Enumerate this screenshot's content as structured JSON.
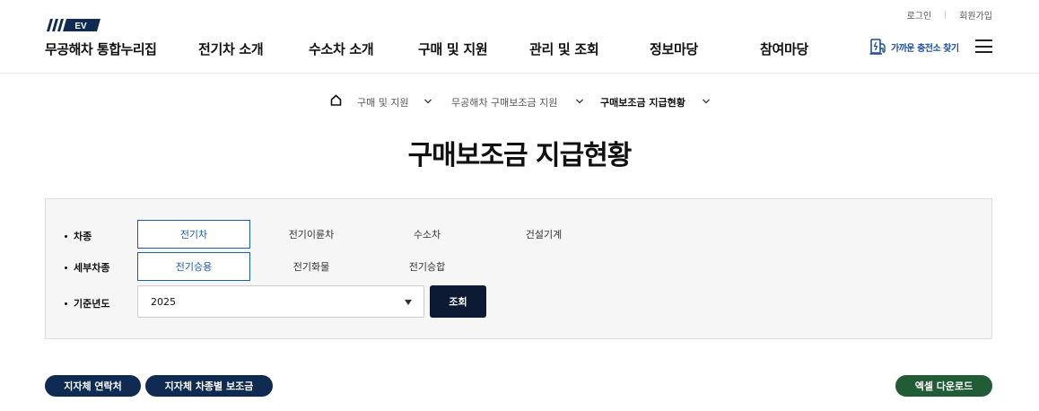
{
  "header": {
    "logo_badge": "EV",
    "logo_text": "무공해차 통합누리집",
    "util": {
      "login": "로그인",
      "signup": "회원가입"
    },
    "nav": [
      "전기차 소개",
      "수소차 소개",
      "구매 및 지원",
      "관리 및 조회",
      "정보마당",
      "참여마당"
    ],
    "charger_label": "가까운 충전소 찾기"
  },
  "breadcrumb": {
    "items": [
      "구매 및 지원",
      "무공해차 구매보조금 지원",
      "구매보조금 지급현황"
    ]
  },
  "page_title": "구매보조금 지급현황",
  "filters": {
    "vehicle_type": {
      "label": "차종",
      "options": [
        "전기차",
        "전기이륜차",
        "수소차",
        "건설기계"
      ],
      "selected": "전기차"
    },
    "sub_type": {
      "label": "세부차종",
      "options": [
        "전기승용",
        "전기화물",
        "전기승합"
      ],
      "selected": "전기승용"
    },
    "year": {
      "label": "기준년도",
      "value": "2025"
    },
    "query_button": "조회"
  },
  "actions": {
    "contact": "지자체 연락처",
    "subsidy": "지자체 차종별 보조금",
    "excel": "엑셀 다운로드"
  },
  "colors": {
    "accent": "#1e5ea8",
    "navy": "#0f2b52",
    "query": "#0c1a33",
    "green": "#215c36"
  }
}
